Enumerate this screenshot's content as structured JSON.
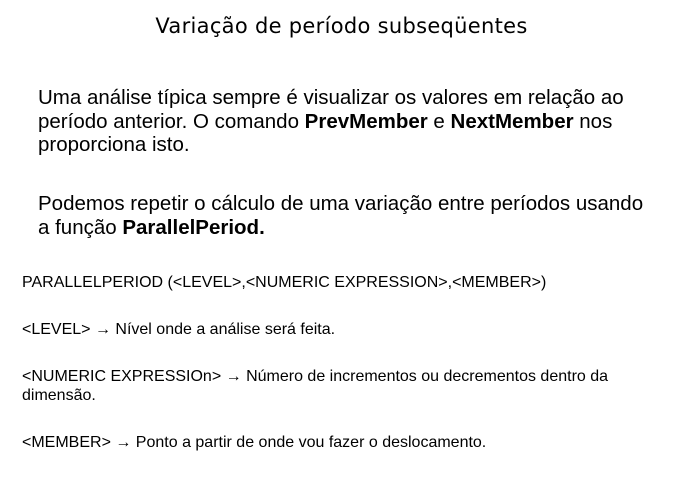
{
  "title": "Variação de período subseqüentes",
  "paragraph1": {
    "text_a": "Uma análise típica sempre é visualizar os valores em relação ao período anterior. O comando ",
    "bold_a": "PrevMember",
    "text_b": " e ",
    "bold_b": "NextMember",
    "text_c": " nos proporciona isto."
  },
  "paragraph2": {
    "text_a": "Podemos repetir o cálculo de uma variação entre períodos usando a função ",
    "bold_a": "ParallelPeriod."
  },
  "syntax": "PARALLELPERIOD (<LEVEL>,<NUMERIC EXPRESSION>,<MEMBER>)",
  "definitions": [
    "<LEVEL> → Nível onde a análise será feita.",
    "<NUMERIC EXPRESSIOn> → Número de  incrementos ou decrementos dentro da dimensão.",
    "<MEMBER> → Ponto a partir de onde vou fazer o deslocamento."
  ]
}
